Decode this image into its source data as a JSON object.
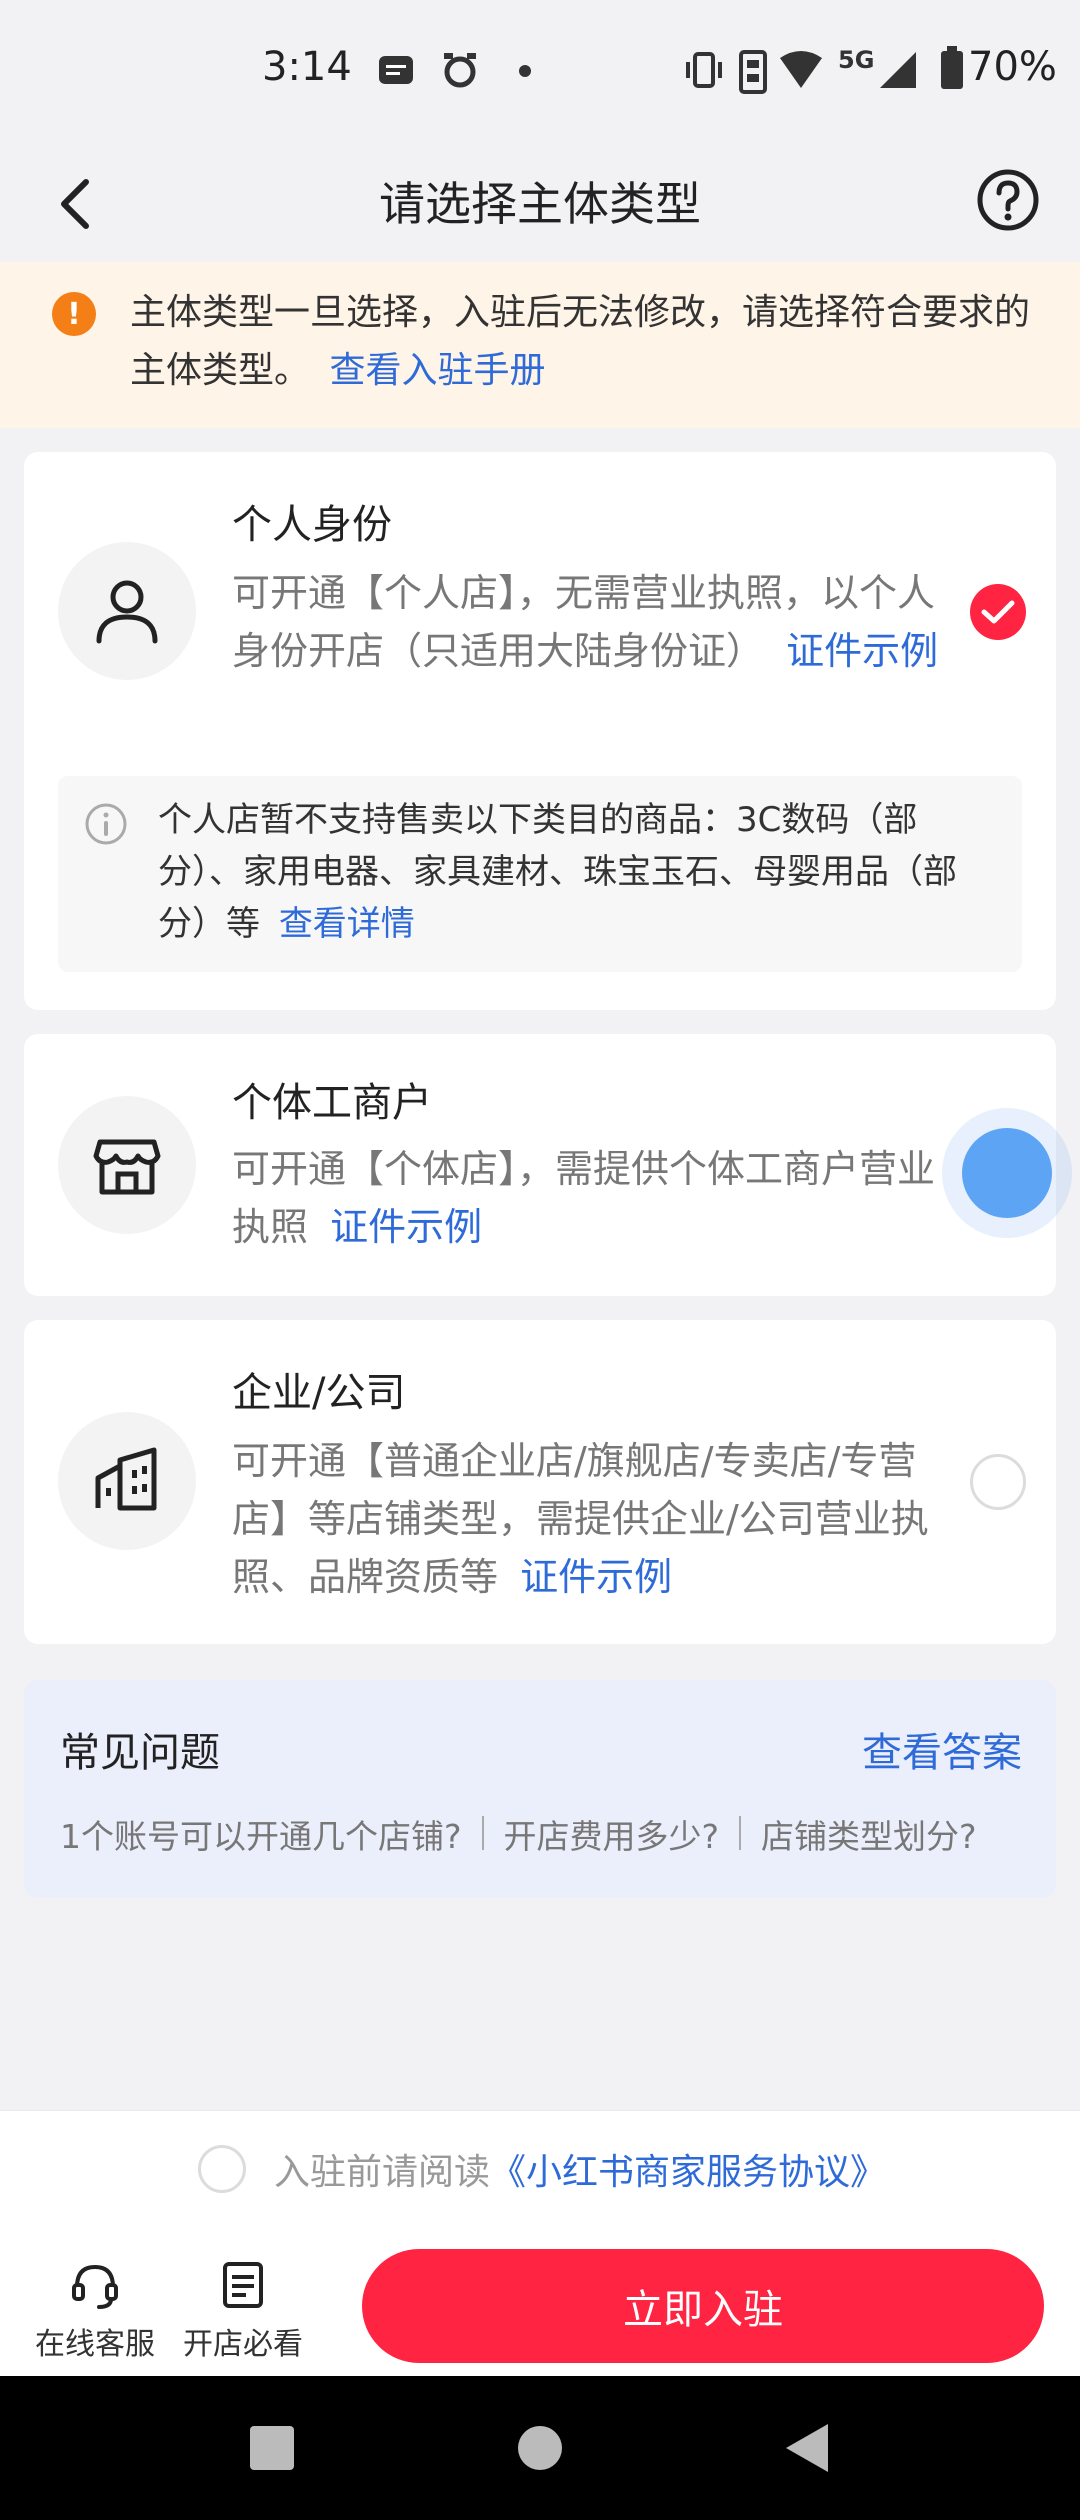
{
  "status_bar": {
    "time": "3:14",
    "network": "5G",
    "battery": "70%"
  },
  "header": {
    "title": "请选择主体类型"
  },
  "notice": {
    "text": "主体类型一旦选择，入驻后无法修改，请选择符合要求的主体类型。",
    "link": "查看入驻手册"
  },
  "options": [
    {
      "title": "个人身份",
      "desc": "可开通【个人店】，无需营业执照，以个人身份开店（只适用大陆身份证）",
      "link": "证件示例",
      "selected": true,
      "tip": {
        "text": "个人店暂不支持售卖以下类目的商品：3C数码（部分）、家用电器、家具建材、珠宝玉石、母婴用品（部分）等",
        "link": "查看详情"
      }
    },
    {
      "title": "个体工商户",
      "desc": "可开通【个体店】，需提供个体工商户营业执照",
      "link": "证件示例",
      "selected": false
    },
    {
      "title": "企业/公司",
      "desc": "可开通【普通企业店/旗舰店/专卖店/专营店】等店铺类型，需提供企业/公司营业执照、品牌资质等",
      "link": "证件示例",
      "selected": false
    }
  ],
  "faq": {
    "title": "常见问题",
    "more": "查看答案",
    "questions": [
      "1个账号可以开通几个店铺?",
      "开店费用多少?",
      "店铺类型划分?"
    ]
  },
  "bottom": {
    "agree_prefix": "入驻前请阅读",
    "agree_link": "《小红书商家服务协议》",
    "service_label": "在线客服",
    "guide_label": "开店必看",
    "submit_label": "立即入驻"
  },
  "colors": {
    "accent": "#ff2442",
    "link": "#2f6bd8",
    "notice_bg": "#fff4e8",
    "faq_bg": "#ebeffc"
  }
}
